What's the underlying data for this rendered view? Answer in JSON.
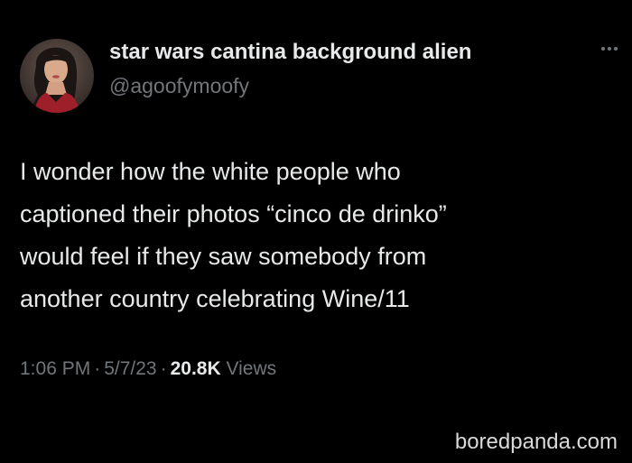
{
  "tweet": {
    "author": {
      "display_name": "star wars cantina background alien",
      "handle": "@agoofymoofy"
    },
    "text_lines": [
      "I wonder how the white people who",
      "captioned their photos “cinco de drinko”",
      "would feel if they saw somebody from",
      "another country celebrating Wine/11"
    ],
    "meta": {
      "time": "1:06 PM",
      "separator": "·",
      "date": "5/7/23",
      "views_count": "20.8K",
      "views_label": "Views"
    }
  },
  "watermark": "boredpanda.com",
  "icons": {
    "more": "more-options-icon"
  },
  "colors": {
    "background": "#000000",
    "primary_text": "#e7e9ea",
    "secondary_text": "#71767b"
  }
}
